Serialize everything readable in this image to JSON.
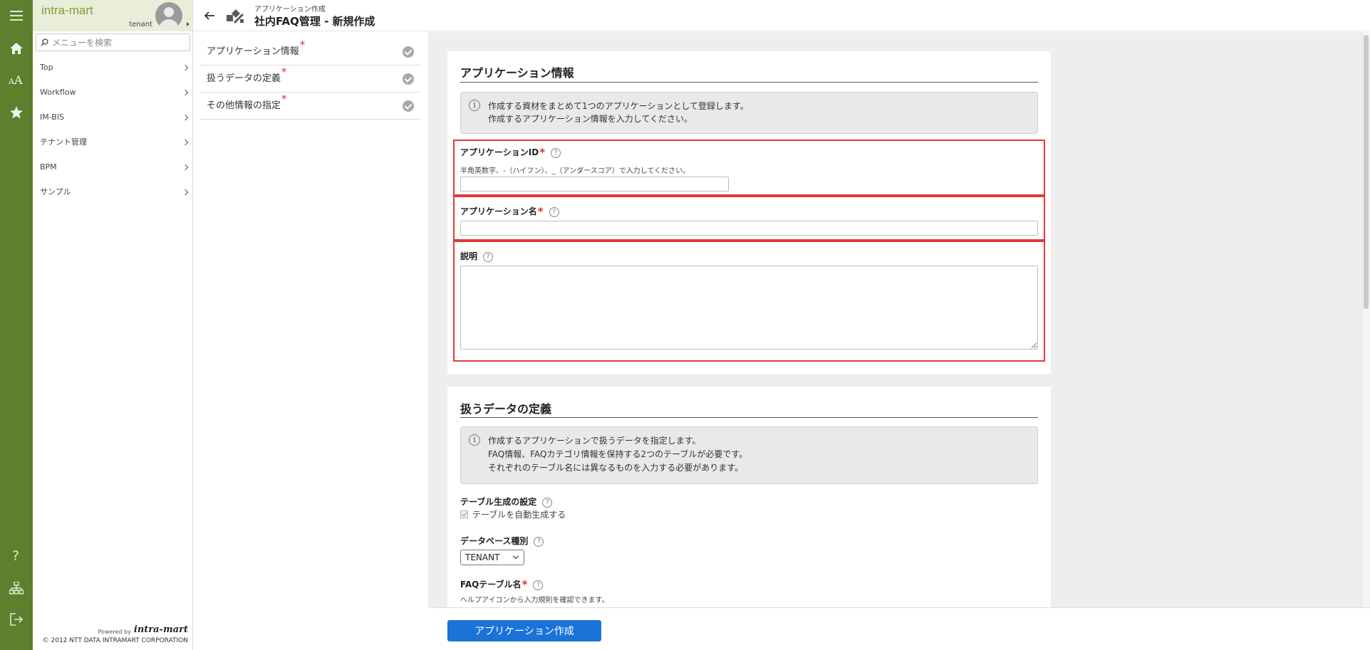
{
  "brand": {
    "name": "intra-mart",
    "user": "tenant"
  },
  "search": {
    "placeholder": "メニューを検索"
  },
  "rail": {
    "items": [
      "menu-icon",
      "home-icon",
      "font-size-icon",
      "favorite-star-icon"
    ],
    "bottom_items": [
      "help-icon",
      "sitemap-icon",
      "logout-icon"
    ],
    "bg_color": "#5d7f2e"
  },
  "menu": {
    "items": [
      {
        "label": "Top"
      },
      {
        "label": "Workflow"
      },
      {
        "label": "IM-BIS"
      },
      {
        "label": "テナント管理"
      },
      {
        "label": "BPM"
      },
      {
        "label": "サンプル"
      }
    ]
  },
  "footer_brand": {
    "powered": "Powered by",
    "logo": "intra-mart",
    "copyright": "© 2012 NTT DATA INTRAMART CORPORATION"
  },
  "header": {
    "breadcrumb": "アプリケーション作成",
    "title": "社内FAQ管理 - 新規作成"
  },
  "steps": [
    {
      "label": "アプリケーション情報",
      "required": "*"
    },
    {
      "label": "扱うデータの定義",
      "required": "*"
    },
    {
      "label": "その他情報の指定",
      "required": "*"
    }
  ],
  "app_info": {
    "title": "アプリケーション情報",
    "info": [
      "作成する資材をまとめて1つのアプリケーションとして登録します。",
      "作成するアプリケーション情報を入力してください。"
    ],
    "app_id": {
      "label": "アプリケーションID",
      "required": "*",
      "hint": "半角英数字、-（ハイフン）、_（アンダースコア）で入力してください。",
      "value": ""
    },
    "app_name": {
      "label": "アプリケーション名",
      "required": "*",
      "value": ""
    },
    "description": {
      "label": "説明",
      "value": ""
    }
  },
  "data_def": {
    "title": "扱うデータの定義",
    "info": [
      "作成するアプリケーションで扱うデータを指定します。",
      "FAQ情報、FAQカテゴリ情報を保持する2つのテーブルが必要です。",
      "それぞれのテーブル名には異なるものを入力する必要があります。"
    ],
    "table_gen": {
      "label": "テーブル生成の設定",
      "checkbox": "テーブルを自動生成する",
      "checked": true
    },
    "db_type": {
      "label": "データベース種別",
      "selected": "TENANT"
    },
    "faq_table": {
      "label": "FAQテーブル名",
      "required": "*",
      "hint": "ヘルプアイコンから入力規則を確認できます。"
    }
  },
  "footer": {
    "submit_label": "アプリケーション作成"
  },
  "colors": {
    "accent": "#1a73d9",
    "highlight_border": "#e53935",
    "required": "#e53030",
    "brand_green": "#7aa13a"
  }
}
